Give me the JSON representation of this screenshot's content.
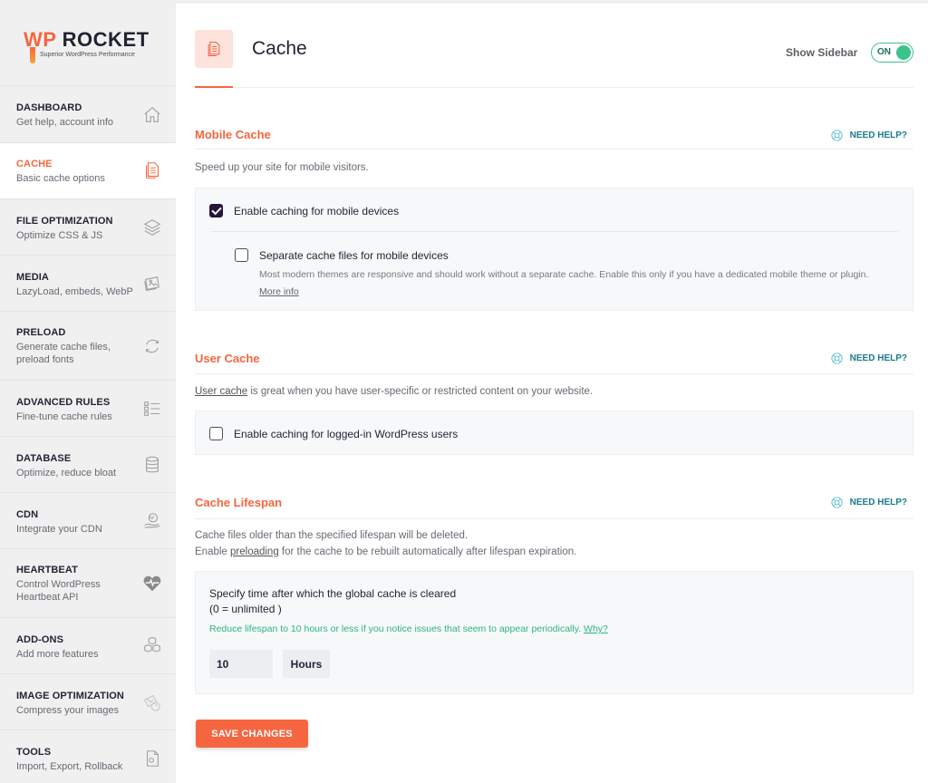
{
  "brand": {
    "name_part1": "WP",
    "name_part2": "ROCKET",
    "tagline": "Superior WordPress Performance",
    "accent_color": "#f56640"
  },
  "sidebar": {
    "items": [
      {
        "title": "DASHBOARD",
        "desc": "Get help, account info",
        "icon": "home-icon",
        "active": false
      },
      {
        "title": "CACHE",
        "desc": "Basic cache options",
        "icon": "document-icon",
        "active": true
      },
      {
        "title": "FILE OPTIMIZATION",
        "desc": "Optimize CSS & JS",
        "icon": "layers-icon",
        "active": false
      },
      {
        "title": "MEDIA",
        "desc": "LazyLoad, embeds, WebP",
        "icon": "images-icon",
        "active": false
      },
      {
        "title": "PRELOAD",
        "desc": "Generate cache files, preload fonts",
        "icon": "refresh-icon",
        "active": false
      },
      {
        "title": "ADVANCED RULES",
        "desc": "Fine-tune cache rules",
        "icon": "list-icon",
        "active": false
      },
      {
        "title": "DATABASE",
        "desc": "Optimize, reduce bloat",
        "icon": "database-icon",
        "active": false
      },
      {
        "title": "CDN",
        "desc": "Integrate your CDN",
        "icon": "globe-hand-icon",
        "active": false
      },
      {
        "title": "HEARTBEAT",
        "desc": "Control WordPress Heartbeat API",
        "icon": "heartbeat-icon",
        "active": false
      },
      {
        "title": "ADD-ONS",
        "desc": "Add more features",
        "icon": "cubes-icon",
        "active": false
      },
      {
        "title": "IMAGE OPTIMIZATION",
        "desc": "Compress your images",
        "icon": "image-optimize-icon",
        "active": false
      },
      {
        "title": "TOOLS",
        "desc": "Import, Export, Rollback",
        "icon": "file-gear-icon",
        "active": false
      }
    ]
  },
  "header": {
    "title": "Cache",
    "show_sidebar_label": "Show Sidebar",
    "toggle_state": "ON"
  },
  "sections": {
    "mobile": {
      "title": "Mobile Cache",
      "help": "NEED HELP?",
      "desc": "Speed up your site for mobile visitors.",
      "option1_label": "Enable caching for mobile devices",
      "option1_checked": true,
      "option2_label": "Separate cache files for mobile devices",
      "option2_checked": false,
      "option2_desc": "Most modern themes are responsive and should work without a separate cache. Enable this only if you have a dedicated mobile theme or plugin.",
      "option2_link": "More info"
    },
    "user": {
      "title": "User Cache",
      "help": "NEED HELP?",
      "desc_link": "User cache",
      "desc_rest": " is great when you have user-specific or restricted content on your website.",
      "option_label": "Enable caching for logged-in WordPress users",
      "option_checked": false
    },
    "lifespan": {
      "title": "Cache Lifespan",
      "help": "NEED HELP?",
      "desc_line1": "Cache files older than the specified lifespan will be deleted.",
      "desc_line2_pre": "Enable ",
      "desc_line2_link": "preloading",
      "desc_line2_post": " for the cache to be rebuilt automatically after lifespan expiration.",
      "field_label_line1": "Specify time after which the global cache is cleared",
      "field_label_line2": "(0 = unlimited )",
      "warning": "Reduce lifespan to 10 hours or less if you notice issues that seem to appear periodically.",
      "warning_link": "Why?",
      "value": "10",
      "unit": "Hours"
    }
  },
  "actions": {
    "save_label": "SAVE CHANGES"
  },
  "colors": {
    "accent": "#f56640",
    "toggle_on": "#3ac48a",
    "help": "#1a7a8a",
    "warning_text": "#2cb583",
    "checkbox_checked": "#28153b"
  }
}
